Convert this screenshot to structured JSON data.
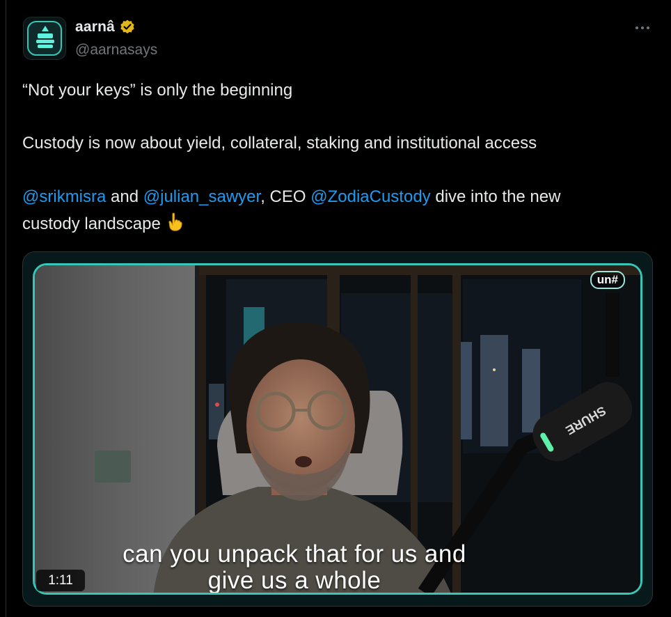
{
  "author": {
    "display_name": "aarnâ",
    "handle": "@aarnasays",
    "verified": true,
    "avatar_icon": "aarna-logo-icon"
  },
  "more_icon": "more-dots-icon",
  "tweet": {
    "line1": "“Not your keys” is only the beginning",
    "line2": "Custody is now about yield, collateral, staking and institutional access",
    "mention1": "@srikmisra",
    "and_text": " and ",
    "mention2": "@julian_sawyer",
    "ceo_text": ", CEO ",
    "mention3": "@ZodiaCustody",
    "tail_text": " dive into the new",
    "line4": "custody landscape",
    "emoji": "👇"
  },
  "video": {
    "brand_badge": "un#",
    "caption_line1": "can you unpack that for us and",
    "caption_line2": "give us a whole",
    "duration": "1:11",
    "mic_brand": "SHURE"
  },
  "colors": {
    "background": "#000000",
    "text": "#e7e9ea",
    "muted": "#71767b",
    "link": "#1d9bf0",
    "accent_frame": "#38c6b7",
    "verified_gold": "#e2b719"
  }
}
